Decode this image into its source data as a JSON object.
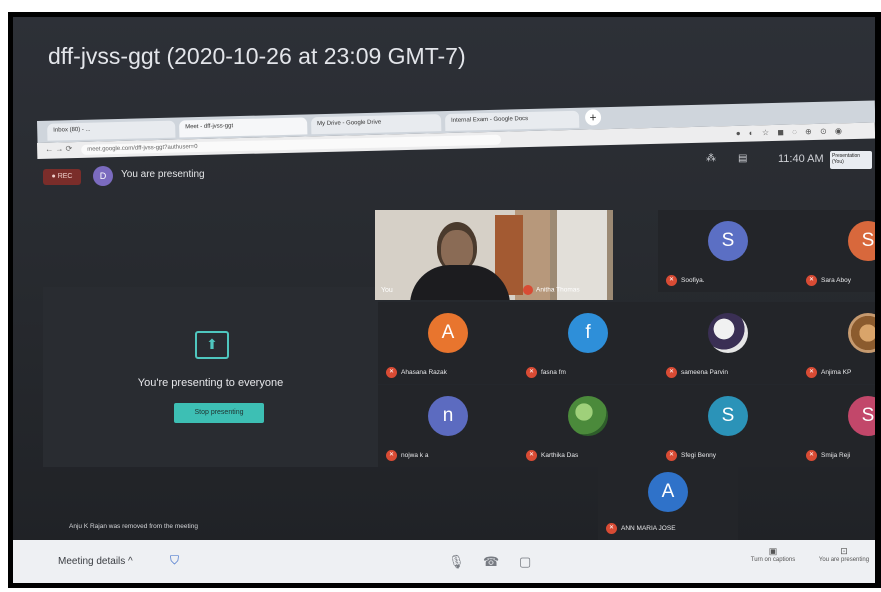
{
  "recording_title": "dff-jvss-ggt (2020-10-26 at 23:09 GMT-7)",
  "browser": {
    "tabs": [
      {
        "label": "Inbox (80) - ..."
      },
      {
        "label": "Meet - dff-jvss-ggt"
      },
      {
        "label": "My Drive - Google Drive"
      },
      {
        "label": "Internal Exam - Google Docs"
      }
    ],
    "new_tab_icon": "plus-icon",
    "url": "meet.google.com/dff-jvss-ggt?authuser=0"
  },
  "header": {
    "rec_label": "REC",
    "presenter_initial": "D",
    "presenting_status": "You are presenting",
    "time": "11:40 AM",
    "presentation_chip": "Presentation (You)"
  },
  "presenting_panel": {
    "message": "You're presenting to everyone",
    "stop_button": "Stop presenting"
  },
  "participants": [
    {
      "name": "You",
      "type": "video"
    },
    {
      "name": "Anitha Thomas",
      "type": "video"
    },
    {
      "name": "Soofiya.",
      "initial": "S",
      "color": "#5b6fc4"
    },
    {
      "name": "Sara Aboy",
      "initial": "S",
      "color": "#d8683c"
    },
    {
      "name": "Ahasana Razak",
      "initial": "A",
      "color": "#e8752e"
    },
    {
      "name": "fasna fm",
      "initial": "f",
      "color": "#2e8fd9"
    },
    {
      "name": "sameena Parvin",
      "type": "photo"
    },
    {
      "name": "Anjima KP",
      "type": "photo"
    },
    {
      "name": "nojwa k a",
      "initial": "n",
      "color": "#5c6bc0"
    },
    {
      "name": "Karthika Das",
      "type": "photo"
    },
    {
      "name": "Sfegi Benny",
      "initial": "S",
      "color": "#2b93b8"
    },
    {
      "name": "Smija Reji",
      "initial": "S",
      "color": "#c2476a"
    },
    {
      "name": "ANN MARIA JOSE",
      "initial": "A",
      "color": "#2f72c9"
    }
  ],
  "toast": "Anju K Rajan was removed from the meeting",
  "bottom_bar": {
    "meeting_details": "Meeting details",
    "captions_label": "Turn on captions",
    "presenting_label": "You are presenting"
  }
}
